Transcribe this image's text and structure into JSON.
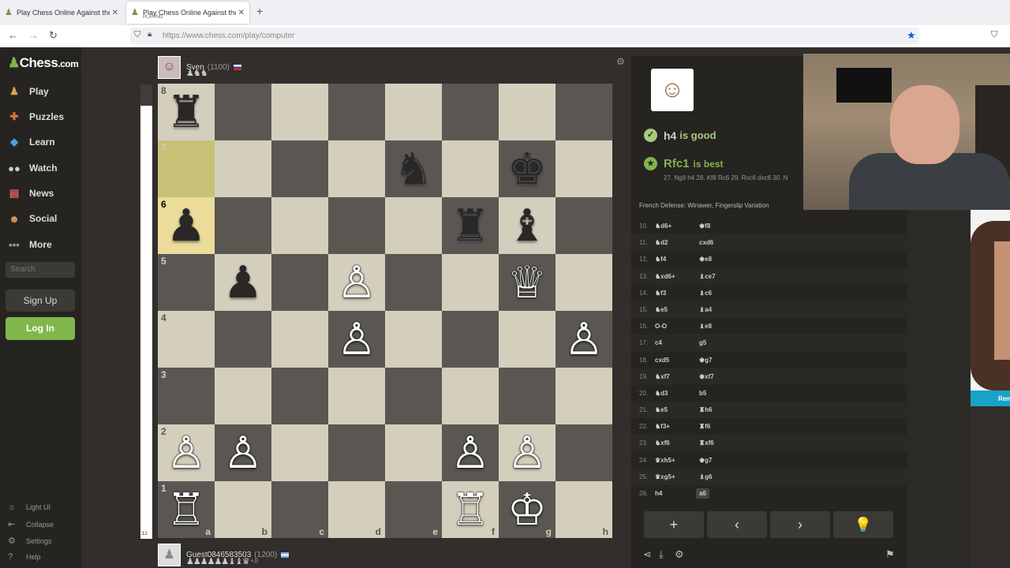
{
  "browser": {
    "tabs": [
      {
        "title": "Play Chess Online Against the C",
        "sub": ""
      },
      {
        "title": "Play Chess Online Against the C",
        "sub": "PLAYING"
      }
    ],
    "url": "https://www.chess.com/play/computer"
  },
  "sidebar": {
    "logo_a": "Chess",
    "logo_b": ".com",
    "items": [
      {
        "label": "Play",
        "icon": "pawn-hand-icon"
      },
      {
        "label": "Puzzles",
        "icon": "puzzle-icon"
      },
      {
        "label": "Learn",
        "icon": "graduation-cap-icon"
      },
      {
        "label": "Watch",
        "icon": "binoculars-icon"
      },
      {
        "label": "News",
        "icon": "newspaper-icon"
      },
      {
        "label": "Social",
        "icon": "people-icon"
      },
      {
        "label": "More",
        "icon": "more-dots-icon"
      }
    ],
    "search_placeholder": "Search",
    "signup": "Sign Up",
    "login": "Log In",
    "bottom": [
      {
        "label": "Light UI",
        "icon": "lightbulb-icon"
      },
      {
        "label": "Collapse",
        "icon": "collapse-icon"
      },
      {
        "label": "Settings",
        "icon": "gear-icon"
      },
      {
        "label": "Help",
        "icon": "help-icon"
      }
    ]
  },
  "eval": {
    "value": "12",
    "fill": 0.047
  },
  "top_player": {
    "name": "Sven",
    "rating": "(1100)",
    "captured": "♟♞♞"
  },
  "bottom_player": {
    "name": "Guest0846583503",
    "rating": "(1200)",
    "captured": "♟♟♟♟♟♟♝♝♛",
    "advantage": "+8"
  },
  "board": {
    "ranks": [
      "8",
      "7",
      "6",
      "5",
      "4",
      "3",
      "2",
      "1"
    ],
    "files": [
      "a",
      "b",
      "c",
      "d",
      "e",
      "f",
      "g",
      "h"
    ],
    "position": [
      [
        "♜",
        "",
        "",
        "",
        "",
        "",
        "",
        ""
      ],
      [
        "",
        "",
        "",
        "",
        "♞",
        "",
        "♚",
        ""
      ],
      [
        "♟",
        "",
        "",
        "",
        "",
        "♜",
        "♝",
        ""
      ],
      [
        "",
        "♟",
        "",
        "♙",
        "",
        "",
        "♕",
        ""
      ],
      [
        "",
        "",
        "",
        "♙",
        "",
        "",
        "",
        "♙"
      ],
      [
        "",
        "",
        "",
        "",
        "",
        "",
        "",
        ""
      ],
      [
        "♙",
        "♙",
        "",
        "",
        "",
        "♙",
        "♙",
        ""
      ],
      [
        "♖",
        "",
        "",
        "",
        "",
        "♖",
        "♔",
        ""
      ]
    ],
    "colors": [
      [
        "b",
        "",
        "",
        "",
        "",
        "",
        "",
        ""
      ],
      [
        "",
        "",
        "",
        "",
        "b",
        "",
        "b",
        ""
      ],
      [
        "b",
        "",
        "",
        "",
        "",
        "b",
        "b",
        ""
      ],
      [
        "",
        "b",
        "",
        "w",
        "",
        "",
        "w",
        ""
      ],
      [
        "",
        "",
        "",
        "w",
        "",
        "",
        "",
        "w"
      ],
      [
        "",
        "",
        "",
        "",
        "",
        "",
        "",
        ""
      ],
      [
        "w",
        "w",
        "",
        "",
        "",
        "w",
        "w",
        ""
      ],
      [
        "w",
        "",
        "",
        "",
        "",
        "w",
        "w",
        ""
      ]
    ]
  },
  "coach": {
    "feedback_move": "h4",
    "feedback_text": "is good",
    "best_move": "Rfc1",
    "best_text": "is best",
    "best_line": "27. Ng8 h4 28. Kf8 Rc6 29. Rxc6 dxc6 30. N",
    "opening": "French Defense: Winawer, Fingerslip Variation"
  },
  "moves": [
    {
      "n": "10.",
      "w": "♞d6+",
      "b": "♚f8"
    },
    {
      "n": "11.",
      "w": "♞d2",
      "b": "cxd6"
    },
    {
      "n": "12.",
      "w": "♞f4",
      "b": "♚e8"
    },
    {
      "n": "13.",
      "w": "♞xd6+",
      "b": "♝ce7"
    },
    {
      "n": "14.",
      "w": "♞f3",
      "b": "♝c6"
    },
    {
      "n": "15.",
      "w": "♞e5",
      "b": "♝a4"
    },
    {
      "n": "16.",
      "w": "O-O",
      "b": "♝e8"
    },
    {
      "n": "17.",
      "w": "c4",
      "b": "g5"
    },
    {
      "n": "18.",
      "w": "cxd5",
      "b": "♚g7"
    },
    {
      "n": "19.",
      "w": "♞xf7",
      "b": "♚xf7"
    },
    {
      "n": "20.",
      "w": "♞d3",
      "b": "b5"
    },
    {
      "n": "21.",
      "w": "♞e5",
      "b": "♜h6"
    },
    {
      "n": "22.",
      "w": "♞f3+",
      "b": "♜f6"
    },
    {
      "n": "23.",
      "w": "♞xf6",
      "b": "♜xf6"
    },
    {
      "n": "24.",
      "w": "♛xh5+",
      "b": "♚g7"
    },
    {
      "n": "25.",
      "w": "♛xg5+",
      "b": "♝g6"
    },
    {
      "n": "26.",
      "w": "h4",
      "b": "a6"
    }
  ],
  "controls": [
    {
      "label": "+",
      "icon": "plus-icon"
    },
    {
      "label": "‹",
      "icon": "chevron-left-icon"
    },
    {
      "label": "›",
      "icon": "chevron-right-icon"
    },
    {
      "label": "💡",
      "icon": "lightbulb-icon"
    }
  ],
  "webcam_caption": "Rem"
}
